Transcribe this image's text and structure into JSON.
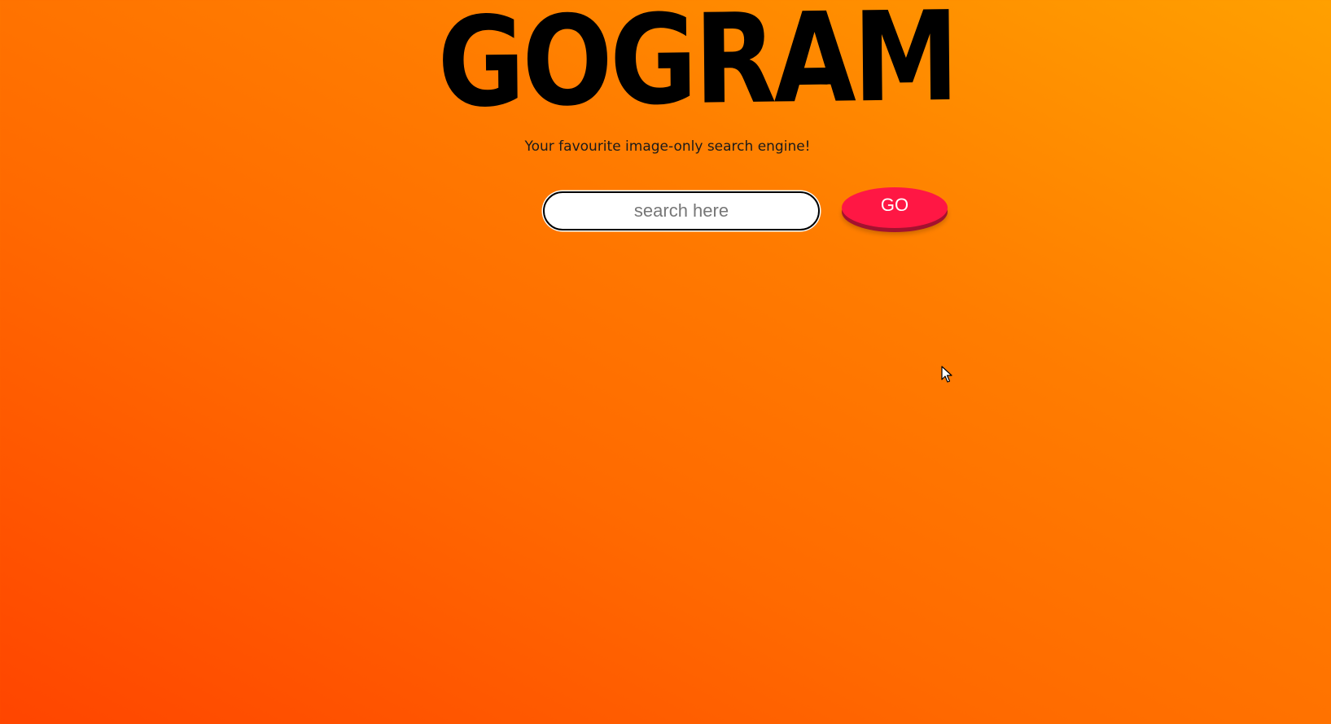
{
  "logo": {
    "text": "GOGRAM"
  },
  "tagline": "Your favourite image-only search engine!",
  "search": {
    "value": "",
    "placeholder": "search here"
  },
  "go_button": {
    "label": "GO"
  },
  "colors": {
    "background_start": "#ff4500",
    "background_end": "#ffa000",
    "button": "#ff1744",
    "button_shadow": "#a3122f",
    "logo": "#000000"
  },
  "icons": {
    "cursor": "mouse-pointer-icon"
  }
}
